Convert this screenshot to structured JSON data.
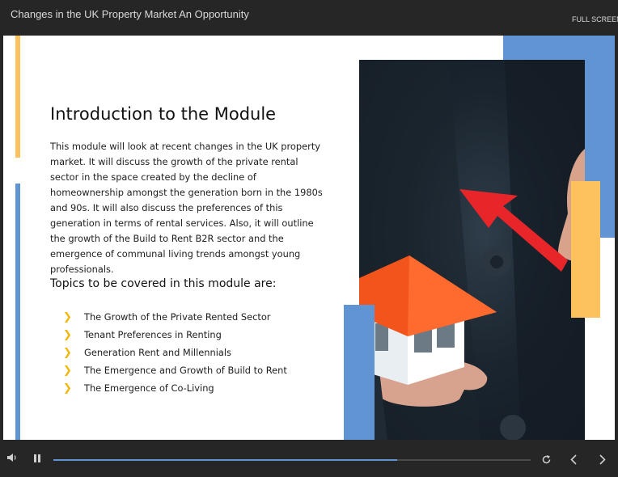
{
  "window": {
    "title": "Changes in the UK Property Market An Opportunity",
    "fullscreen_label": "FULL SCREEN"
  },
  "slide": {
    "heading": "Introduction to the Module",
    "intro": "This module will look at recent changes in the UK property market. It will discuss the growth of the private rental sector in the space created by the decline of homeownership amongst the generation born in the 1980s and 90s. It will also discuss the preferences of this generation in terms of rental services.  Also, it will outline the growth of the Build to Rent B2R sector and the emergence of communal living trends amongst young professionals.",
    "topics_heading": "Topics to be covered in this module are:",
    "topics": [
      "The Growth of the Private Rented Sector",
      "Tenant Preferences in Renting",
      "Generation Rent and Millennials",
      "The Emergence and Growth of Build to Rent",
      "The Emergence of Co-Living"
    ],
    "bullet_icon": "chevron-right-icon",
    "image_subject": "hand-holding-house-with-arrow"
  },
  "player": {
    "progress_percent": 72,
    "icons": [
      "volume-icon",
      "pause-icon",
      "replay-icon",
      "previous-icon",
      "next-icon"
    ]
  },
  "colors": {
    "accent_yellow": "#fdc25e",
    "accent_blue": "#6094d3",
    "chevron": "#f2b705",
    "roof": "#f2541b",
    "arrow": "#e8262a",
    "chrome_bg": "#262626"
  }
}
